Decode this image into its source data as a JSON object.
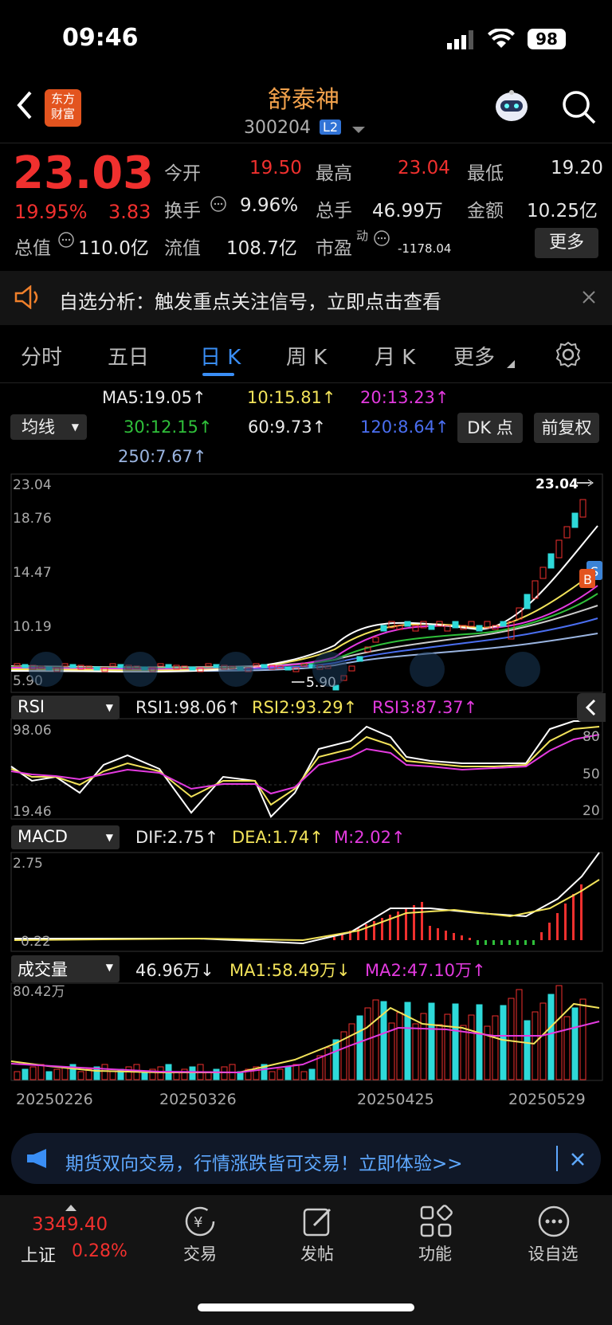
{
  "status": {
    "time": "09:46",
    "battery": "98"
  },
  "header": {
    "title": "舒泰神",
    "code": "300204",
    "badge": "L2"
  },
  "quote": {
    "price": "23.03",
    "change_pct": "19.95%",
    "change": "3.83",
    "open_label": "今开",
    "open": "19.50",
    "high_label": "最高",
    "high": "23.04",
    "low_label": "最低",
    "low": "19.20",
    "turnover_label": "换手",
    "turnover": "9.96%",
    "volume_label": "总手",
    "volume": "46.99万",
    "amount_label": "金额",
    "amount": "10.25亿",
    "mcap_label": "总值",
    "mcap": "110.0亿",
    "float_label": "流值",
    "float": "108.7亿",
    "pe_label": "市盈",
    "pe_sup": "动",
    "pe": "-1178.04",
    "more": "更多"
  },
  "notice": {
    "text": "自选分析：触发重点关注信号，立即点击查看"
  },
  "tabs": [
    "分时",
    "五日",
    "日 K",
    "周 K",
    "月 K",
    "更多"
  ],
  "active_tab": "日 K",
  "ma": {
    "selector": "均线",
    "dk": "DK 点",
    "fq": "前复权",
    "ma5": "MA5:19.05",
    "ma10": "10:15.81",
    "ma20": "20:13.23",
    "ma30": "30:12.15",
    "ma60": "60:9.73",
    "ma120": "120:8.64",
    "ma250": "250:7.67",
    "arrow": "↑"
  },
  "kline": {
    "yticks": [
      "23.04",
      "18.76",
      "14.47",
      "10.19",
      "5.90"
    ],
    "high_mark": "23.04",
    "low_mark": "5.90",
    "colors": {
      "up": "#f0302e",
      "down": "#2ed9d9",
      "ma5": "#ffffff",
      "ma10": "#f2e35a",
      "ma20": "#e33adf",
      "ma30": "#2fbf3a",
      "ma60": "#cccccc",
      "ma120": "#4a6ef0",
      "ma250": "#9ab4e0"
    }
  },
  "rsi": {
    "label": "RSI",
    "rsi1": "RSI1:98.06",
    "rsi2": "RSI2:93.29",
    "rsi3": "RSI3:87.37",
    "yticks": [
      "98.06",
      "19.46"
    ],
    "right_ticks": [
      "80",
      "50",
      "20"
    ]
  },
  "macd": {
    "label": "MACD",
    "dif": "DIF:2.75",
    "dea": "DEA:1.74",
    "m": "M:2.02",
    "yticks": [
      "2.75",
      "0.22"
    ]
  },
  "vol": {
    "label": "成交量",
    "value": "46.96万",
    "ma1": "MA1:58.49万",
    "ma2": "MA2:47.10万",
    "ytick": "80.42万",
    "arrow_down": "↓"
  },
  "dates": [
    "20250226",
    "20250326",
    "20250425",
    "20250529"
  ],
  "banner": {
    "text": "期货双向交易，行情涨跌皆可交易！立即体验>>"
  },
  "bottom": {
    "index_value": "3349.40",
    "index_name": "上证",
    "index_pct": "0.28%",
    "nav": [
      "交易",
      "发帖",
      "功能",
      "设自选"
    ]
  }
}
